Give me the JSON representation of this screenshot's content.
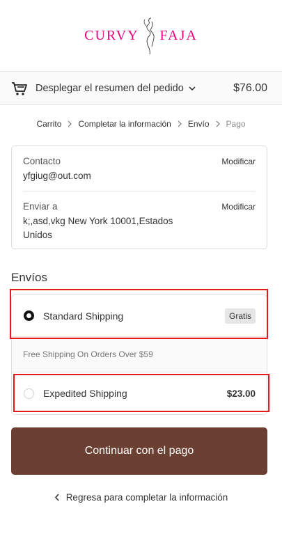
{
  "brand": {
    "part1": "CURVY",
    "part2": "FAJA",
    "color": "#e6007e"
  },
  "summary": {
    "label": "Desplegar el resumen del pedido",
    "total": "$76.00"
  },
  "breadcrumb": {
    "cart": "Carrito",
    "info": "Completar la información",
    "shipping": "Envío",
    "payment": "Pago"
  },
  "review": {
    "contact_label": "Contacto",
    "contact_value": "yfgiug@out.com",
    "ship_label": "Enviar a",
    "ship_value": "k;,asd,vkg New York 10001,Estados Unidos",
    "modify": "Modificar"
  },
  "shipping": {
    "title": "Envíos",
    "options": [
      {
        "label": "Standard Shipping",
        "price": "Gratis",
        "selected": true
      },
      {
        "label": "Expedited Shipping",
        "price": "$23.00",
        "selected": false
      }
    ],
    "note": "Free Shipping On Orders Over $59"
  },
  "actions": {
    "continue": "Continuar con el pago",
    "back": "Regresa para completar la información"
  },
  "colors": {
    "button": "#6b4033",
    "highlight": "#e8191d"
  }
}
